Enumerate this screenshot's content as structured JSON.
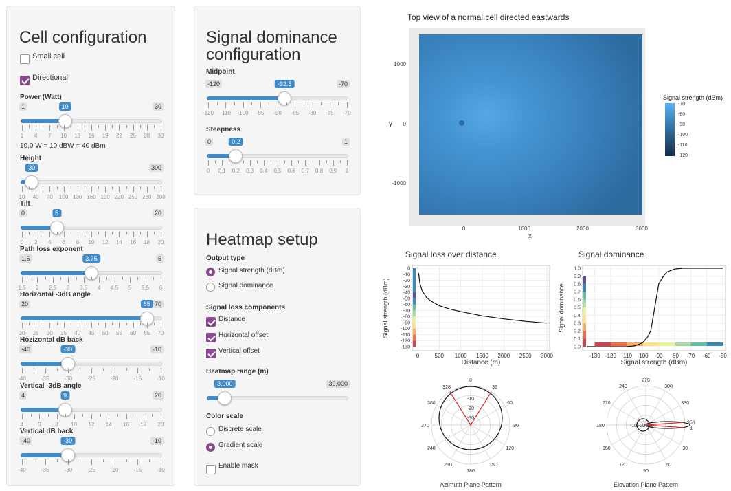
{
  "left": {
    "title": "Cell configuration",
    "small_cell": "Small cell",
    "directional": "Directional",
    "power": {
      "label": "Power (Watt)",
      "min": "1",
      "max": "30",
      "value": "10",
      "ticks": [
        "1",
        "4",
        "7",
        "10",
        "13",
        "16",
        "19",
        "22",
        "25",
        "28",
        "30"
      ],
      "note": "10.0 W = 10 dBW = 40 dBm"
    },
    "height": {
      "label": "Height",
      "min": "",
      "max": "300",
      "value": "30",
      "ticks": [
        "10",
        "40",
        "70",
        "100",
        "130",
        "160",
        "190",
        "220",
        "250",
        "280",
        "300"
      ]
    },
    "tilt": {
      "label": "Tilt",
      "min": "0",
      "max": "20",
      "value": "5",
      "ticks": [
        "0",
        "2",
        "4",
        "6",
        "8",
        "10",
        "12",
        "14",
        "16",
        "18",
        "20"
      ]
    },
    "ple": {
      "label": "Path loss exponent",
      "min": "1.5",
      "max": "6",
      "value": "3.75",
      "ticks": [
        "1.5",
        "2",
        "2.5",
        "3",
        "3.5",
        "4",
        "4.5",
        "5",
        "5.5",
        "6"
      ]
    },
    "hangle": {
      "label": "Horizontal -3dB angle",
      "min": "20",
      "max": "70",
      "value": "65",
      "ticks": [
        "20",
        "25",
        "30",
        "35",
        "40",
        "45",
        "50",
        "55",
        "60",
        "65",
        "70"
      ]
    },
    "hback": {
      "label": "Hozizontal dB back",
      "min": "-40",
      "max": "-10",
      "value": "-30",
      "ticks": [
        "-40",
        "-35",
        "-30",
        "-25",
        "-20",
        "-15",
        "-10"
      ]
    },
    "vangle": {
      "label": "Vertical -3dB angle",
      "min": "4",
      "max": "20",
      "value": "9",
      "ticks": [
        "4",
        "6",
        "8",
        "10",
        "12",
        "14",
        "16",
        "18",
        "20"
      ]
    },
    "vback": {
      "label": "Vertical dB back",
      "min": "-40",
      "max": "-10",
      "value": "-30",
      "ticks": [
        "-40",
        "-35",
        "-30",
        "-25",
        "-20",
        "-15",
        "-10"
      ]
    }
  },
  "dom": {
    "title1": "Signal dominance",
    "title2": "configuration",
    "midpoint": {
      "label": "Midpoint",
      "min": "-120",
      "max": "-70",
      "value": "-92.5",
      "ticks": [
        "-120",
        "-110",
        "-100",
        "-95",
        "-90",
        "-85",
        "-80",
        "-75",
        "-70"
      ]
    },
    "steep": {
      "label": "Steepness",
      "min": "0",
      "max": "1",
      "value": "0.2",
      "ticks": [
        "0",
        "0.1",
        "0.2",
        "0.3",
        "0.4",
        "0.5",
        "0.6",
        "0.7",
        "0.8",
        "0.9",
        "1"
      ]
    }
  },
  "heat": {
    "title": "Heatmap setup",
    "output_label": "Output type",
    "opt_strength": "Signal strength (dBm)",
    "opt_dominance": "Signal dominance",
    "loss_label": "Signal loss components",
    "loss_distance": "Distance",
    "loss_horizontal": "Horizontal offset",
    "loss_vertical": "Vertical offset",
    "range": {
      "label": "Heatmap range (m)",
      "min": "",
      "max": "30,000",
      "value": "3,000"
    },
    "color_label": "Color scale",
    "discrete": "Discrete scale",
    "gradient": "Gradient scale",
    "mask": "Enable mask"
  },
  "map": {
    "title": "Top view of a normal cell directed eastwards",
    "xlabel": "x",
    "ylabel": "y",
    "xticks": [
      "0",
      "1000",
      "2000",
      "3000"
    ],
    "yticks": [
      "1000",
      "0",
      "-1000"
    ],
    "legend_title": "Signal strength (dBm)",
    "legend_ticks": [
      "-70",
      "-80",
      "-90",
      "-100",
      "-110",
      "-120"
    ]
  },
  "colors": {
    "accent": "#8a4a8e",
    "slider": "#428bca"
  },
  "chart_data": [
    {
      "type": "line",
      "title": "Signal loss over distance",
      "xlabel": "Distance (m)",
      "ylabel": "Signal strength (dBm)",
      "xlim": [
        0,
        3000
      ],
      "ylim": [
        -130,
        0
      ],
      "xticks": [
        "0",
        "500",
        "1000",
        "1500",
        "2000",
        "2500",
        "3000"
      ],
      "yticks": [
        "0",
        "-10",
        "-20",
        "-30",
        "-40",
        "-50",
        "-60",
        "-70",
        "-80",
        "-90",
        "-100",
        "-110",
        "-120",
        "-130"
      ],
      "x": [
        20,
        50,
        100,
        200,
        300,
        500,
        750,
        1000,
        1500,
        2000,
        2500,
        3000
      ],
      "y": [
        -8,
        -25,
        -37,
        -48,
        -54,
        -62,
        -68,
        -72,
        -79,
        -84,
        -88,
        -91
      ]
    },
    {
      "type": "line",
      "title": "Signal dominance",
      "xlabel": "Signal strength (dBm)",
      "ylabel": "Signal dominance",
      "xlim": [
        -135,
        -50
      ],
      "ylim": [
        0,
        1
      ],
      "xticks": [
        "-130",
        "-120",
        "-110",
        "-100",
        "-90",
        "-80",
        "-70",
        "-60",
        "-50"
      ],
      "yticks": [
        "0.0",
        "0.1",
        "0.2",
        "0.3",
        "0.4",
        "0.5",
        "0.6",
        "0.7",
        "0.8",
        "0.9",
        "1.0"
      ],
      "x": [
        -135,
        -120,
        -110,
        -105,
        -100,
        -97,
        -95,
        -92.5,
        -90,
        -87,
        -85,
        -80,
        -75,
        -70,
        -60,
        -50
      ],
      "y": [
        0,
        0,
        0.002,
        0.01,
        0.05,
        0.12,
        0.2,
        0.5,
        0.8,
        0.9,
        0.95,
        0.99,
        1,
        1,
        1,
        1
      ]
    },
    {
      "type": "polar",
      "title": "Azimuth Plane Pattern",
      "angle_labels": [
        "0",
        "32",
        "60",
        "90",
        "120",
        "150",
        "180",
        "210",
        "240",
        "270",
        "300",
        "328"
      ],
      "radial_labels": [
        "-10",
        "-20",
        "-30"
      ]
    },
    {
      "type": "polar",
      "title": "Elevation Plane Pattern",
      "angle_labels": [
        "270",
        "300",
        "330",
        "356",
        "4",
        "30",
        "60",
        "90",
        "120",
        "150",
        "180",
        "210",
        "240"
      ],
      "radial_labels": [
        "-10",
        "-20",
        "-30"
      ]
    }
  ]
}
